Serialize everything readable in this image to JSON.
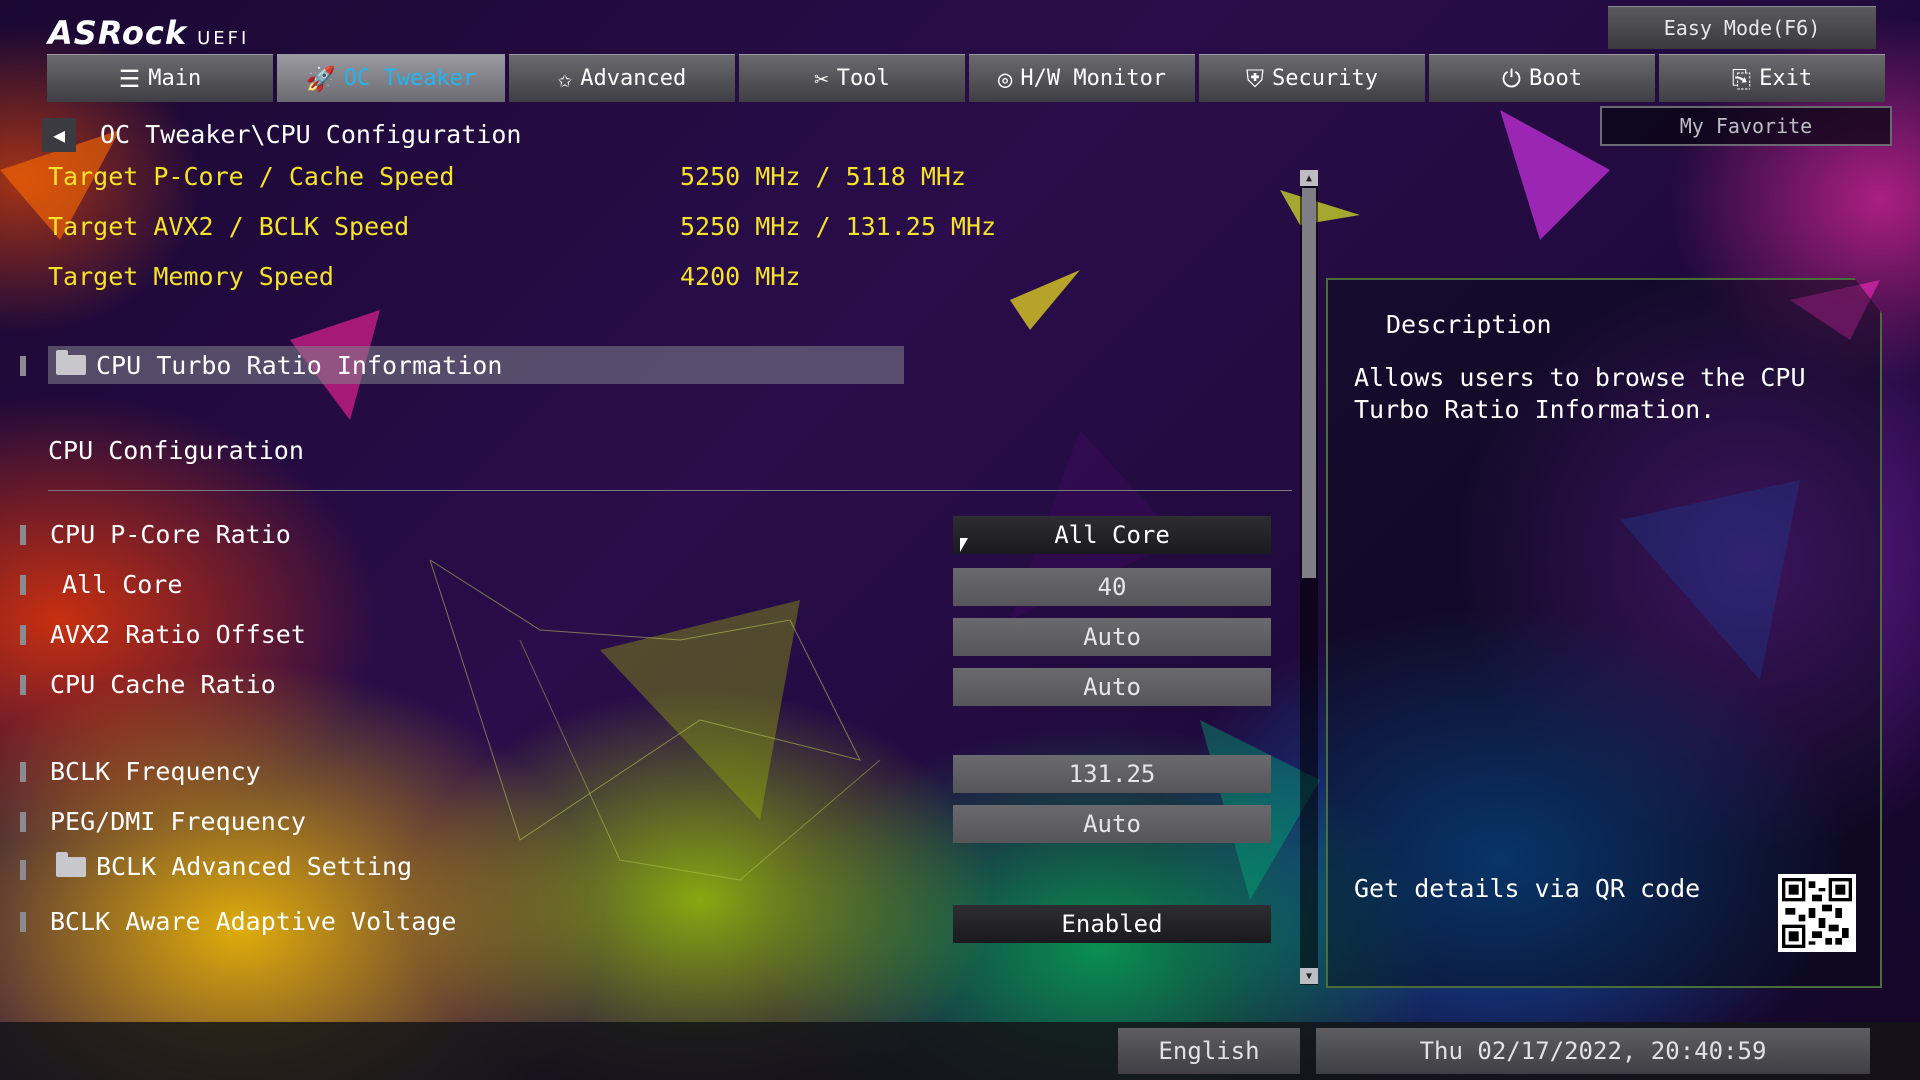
{
  "brand": {
    "name": "ASRock",
    "sub": "UEFI"
  },
  "easy_mode": "Easy Mode(F6)",
  "my_favorite": "My Favorite",
  "tabs": [
    {
      "label": "Main",
      "icon": "list-icon",
      "glyph": "☰"
    },
    {
      "label": "OC Tweaker",
      "icon": "rocket-icon",
      "glyph": "🚀"
    },
    {
      "label": "Advanced",
      "icon": "star-icon",
      "glyph": "✩"
    },
    {
      "label": "Tool",
      "icon": "tools-icon",
      "glyph": "✂"
    },
    {
      "label": "H/W Monitor",
      "icon": "monitor-icon",
      "glyph": "◎"
    },
    {
      "label": "Security",
      "icon": "shield-icon",
      "glyph": "⛨"
    },
    {
      "label": "Boot",
      "icon": "power-icon",
      "glyph": "⏻"
    },
    {
      "label": "Exit",
      "icon": "exit-icon",
      "glyph": "⎘"
    }
  ],
  "active_tab": "OC Tweaker",
  "breadcrumb": "OC Tweaker\\CPU Configuration",
  "targets": [
    {
      "label": "Target P-Core / Cache Speed",
      "value": "5250 MHz / 5118 MHz"
    },
    {
      "label": "Target AVX2 / BCLK Speed",
      "value": "5250 MHz / 131.25 MHz"
    },
    {
      "label": "Target Memory Speed",
      "value": "4200 MHz"
    }
  ],
  "turbo_info": "CPU Turbo Ratio Information",
  "section_title": "CPU Configuration",
  "items": [
    {
      "label": "CPU P-Core Ratio",
      "value": "All Core"
    },
    {
      "label": " All Core",
      "value": "40"
    },
    {
      "label": "AVX2 Ratio Offset",
      "value": "Auto"
    },
    {
      "label": "CPU Cache  Ratio",
      "value": "Auto"
    },
    {
      "label": "BCLK Frequency",
      "value": "131.25"
    },
    {
      "label": "PEG/DMI Frequency",
      "value": "Auto"
    },
    {
      "label": "BCLK Advanced Setting",
      "value": ""
    },
    {
      "label": "BCLK Aware Adaptive Voltage",
      "value": "Enabled"
    }
  ],
  "description": {
    "title": "Description",
    "text": "Allows users to browse the CPU Turbo Ratio Information.",
    "qr_label": "Get details via QR code"
  },
  "footer": {
    "language": "English",
    "datetime": "Thu 02/17/2022, 20:40:59"
  },
  "colors": {
    "accent_yellow": "#f4e32a",
    "active_tab_text": "#23b5f0"
  }
}
